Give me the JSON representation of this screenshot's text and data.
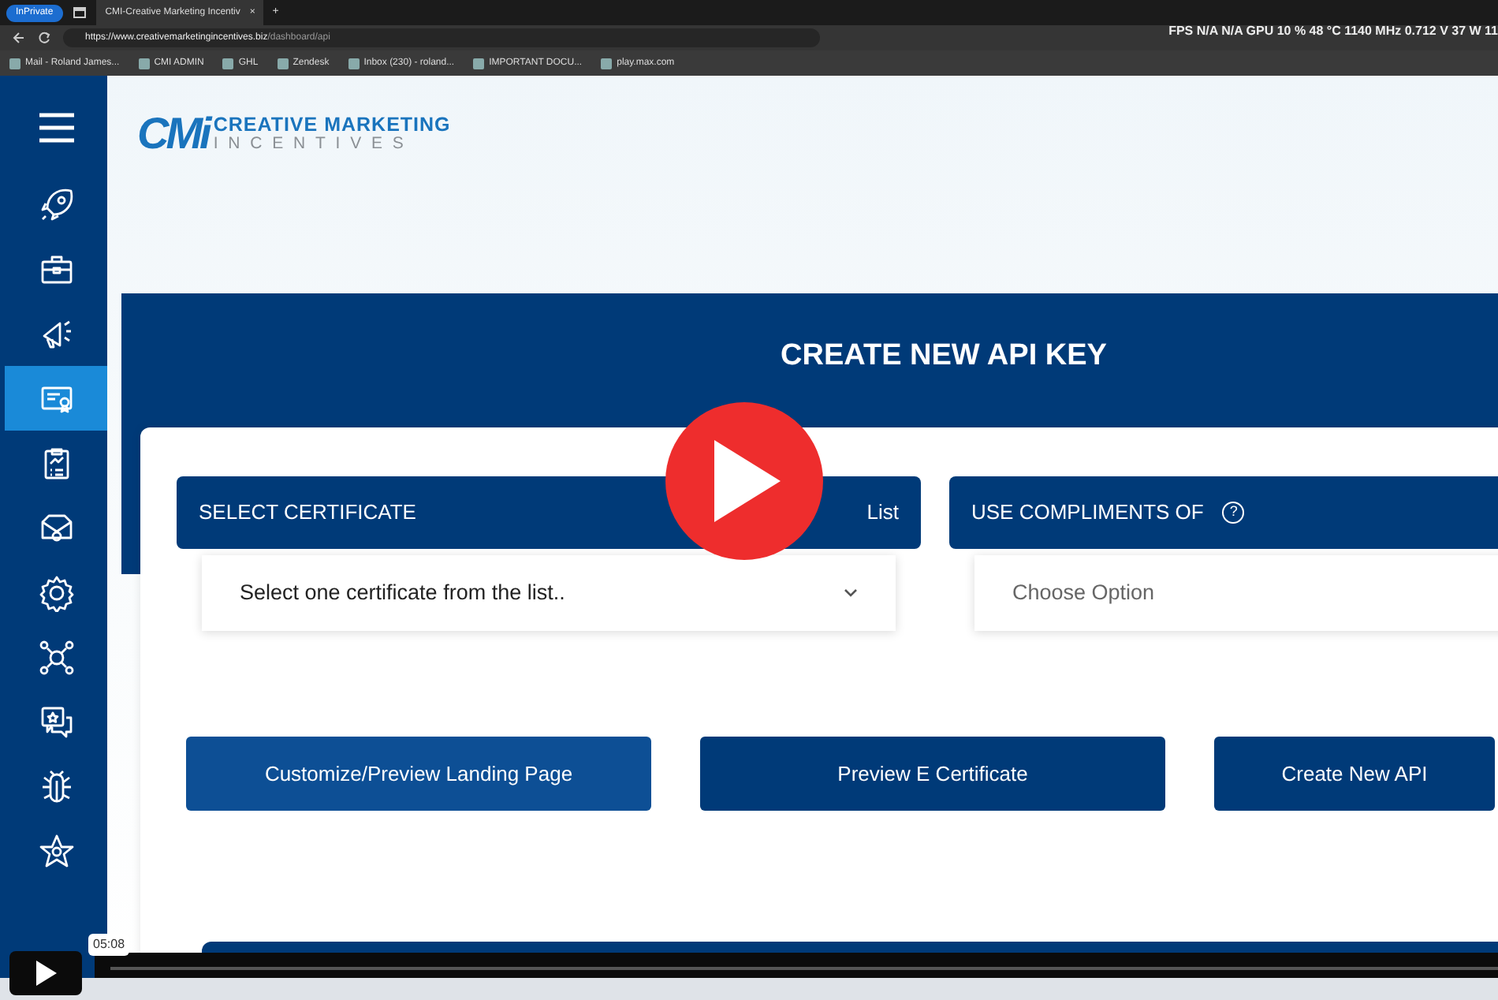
{
  "browser": {
    "private_badge": "InPrivate",
    "tabs": [
      {
        "title": "CMI-Creative Marketing Incentiv",
        "close": "×",
        "selected": true
      }
    ],
    "new_tab": "+",
    "url": {
      "host": "https://www.creativemarketingincentives.biz",
      "path": "/dashboard/api"
    },
    "bookmarks": [
      {
        "label": "Mail - Roland James..."
      },
      {
        "label": "CMI ADMIN"
      },
      {
        "label": "GHL"
      },
      {
        "label": "Zendesk"
      },
      {
        "label": "Inbox (230) - roland..."
      },
      {
        "label": "IMPORTANT DOCU..."
      },
      {
        "label": "play.max.com"
      }
    ],
    "overlay_stats": "FPS N/A N/A GPU 10 % 48 °C 1140 MHz 0.712 V 37 W 11"
  },
  "logo": {
    "mark": "CMi",
    "line1": "CREATIVE MARKETING",
    "line2": "INCENTIVES"
  },
  "sidebar": {
    "items": [
      {
        "selected": false
      },
      {
        "selected": false
      },
      {
        "selected": false
      },
      {
        "selected": true
      },
      {
        "selected": false
      },
      {
        "selected": false
      },
      {
        "selected": false
      },
      {
        "selected": false
      },
      {
        "selected": false
      },
      {
        "selected": false
      },
      {
        "selected": false
      }
    ]
  },
  "page": {
    "title": "CREATE NEW API KEY",
    "fields": [
      {
        "label": "SELECT CERTIFICATE",
        "link": "List",
        "value": "Select one certificate from the list.."
      },
      {
        "label": "USE COMPLIMENTS OF",
        "help": "?",
        "placeholder": "Choose Option"
      }
    ],
    "buttons": [
      {
        "label": "Customize/Preview Landing Page",
        "highlighted": true
      },
      {
        "label": "Preview E Certificate",
        "highlighted": false
      },
      {
        "label": "Create New API",
        "highlighted": false
      }
    ]
  },
  "player": {
    "time": "05:08"
  }
}
